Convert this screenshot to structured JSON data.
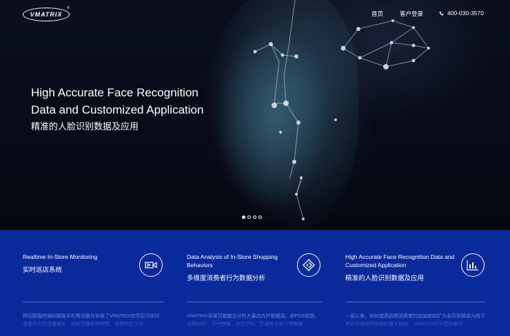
{
  "header": {
    "logo_text": "VMATRIX",
    "logo_mark": "®",
    "nav": {
      "home": "首页",
      "login": "客户登录",
      "phone": "400-030-3570"
    },
    "phone_icon": "phone-icon"
  },
  "hero": {
    "title_line1": "High Accurate Face Recognition",
    "title_line2": "Data and Customized Application",
    "subtitle": "精准的人脸识别数据及应用",
    "slides": {
      "count": 4,
      "active": 1
    }
  },
  "features": [
    {
      "title_en": "Realtime In-Store Monitoring",
      "title_cn": "实时巡店系统",
      "icon": "video-camera-icon",
      "body": "移动智能终端如智能手机等设备在安装了VMATRIX软件后可实时查看店内高清摄像头，轻松切换和观察图，并提供在工作"
    },
    {
      "title_en": "Data Analysis of In-Store Shopping Behaviors",
      "title_cn": "多维度消费者行为数据分析",
      "icon": "data-analysis-icon",
      "body": "VMATRIX系统可整整合分析大量店内外数据源，如POS收银、访客WIFI、天气数据、会员识别、区域热点统计等数据"
    },
    {
      "title_en": "High Accurate Face Recognition Data and Customized Application",
      "title_cn": "精准的人脸识别数据及应用",
      "icon": "bar-chart-icon",
      "body": "一直以来，如何提高品牌消费者的忠诚度和扩大会员规模成为线下商业实体店所面临的重大挑战，VMATRIX作为国内最早"
    }
  ],
  "colors": {
    "hero_bg": "#070b17",
    "feature_bg": "#0a2a9c",
    "text": "#ffffff"
  }
}
